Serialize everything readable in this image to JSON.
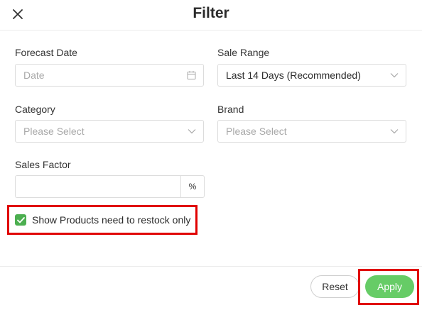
{
  "header": {
    "title": "Filter",
    "close_icon": "close-icon"
  },
  "form": {
    "forecast_date": {
      "label": "Forecast Date",
      "placeholder": "Date",
      "icon": "calendar-icon"
    },
    "sale_range": {
      "label": "Sale Range",
      "value": "Last 14 Days (Recommended)",
      "icon": "chevron-down-icon"
    },
    "category": {
      "label": "Category",
      "placeholder": "Please Select",
      "icon": "chevron-down-icon"
    },
    "brand": {
      "label": "Brand",
      "placeholder": "Please Select",
      "icon": "chevron-down-icon"
    },
    "sales_factor": {
      "label": "Sales Factor",
      "value": "",
      "suffix": "%"
    },
    "restock_only": {
      "label": "Show Products need to restock only",
      "checked": true
    }
  },
  "footer": {
    "reset_label": "Reset",
    "apply_label": "Apply"
  },
  "colors": {
    "accent": "#66cc66",
    "checkbox": "#4caf50",
    "highlight": "#e00000"
  }
}
